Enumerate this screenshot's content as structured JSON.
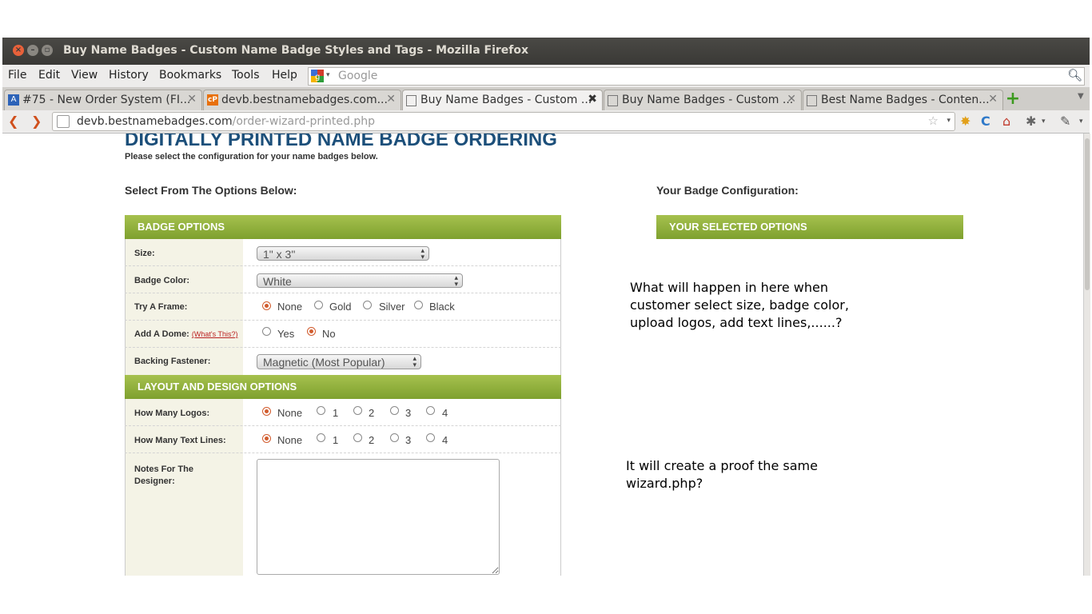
{
  "window": {
    "title": "Buy Name Badges - Custom Name Badge Styles and Tags - Mozilla Firefox"
  },
  "menubar": {
    "items": [
      "File",
      "Edit",
      "View",
      "History",
      "Bookmarks",
      "Tools",
      "Help"
    ],
    "search_placeholder": "Google"
  },
  "tabs": [
    {
      "label": "#75 - New Order System (FI...",
      "favicon": "A",
      "active": false
    },
    {
      "label": "devb.bestnamebadges.com...",
      "favicon": "cP",
      "active": false
    },
    {
      "label": "Buy Name Badges - Custom ...",
      "favicon": "",
      "active": true
    },
    {
      "label": "Buy Name Badges - Custom ...",
      "favicon": "",
      "active": false
    },
    {
      "label": "Best Name Badges - Conten...",
      "favicon": "",
      "active": false
    }
  ],
  "navbar": {
    "url_domain": "devb.bestnamebadges.com",
    "url_path": "/order-wizard-printed.php"
  },
  "page": {
    "title": "DIGITALLY PRINTED NAME BADGE ORDERING",
    "subtitle": "Please select the configuration for your name badges below.",
    "left_heading": "Select From The Options Below:",
    "right_heading": "Your Badge Configuration:",
    "badge_options_header": "BADGE OPTIONS",
    "selected_options_header": "YOUR SELECTED OPTIONS",
    "layout_header": "LAYOUT AND DESIGN OPTIONS",
    "rows": {
      "size": {
        "label": "Size:",
        "value": "1\" x 3\""
      },
      "badge_color": {
        "label": "Badge Color:",
        "value": "White"
      },
      "frame": {
        "label": "Try A Frame:",
        "options": [
          "None",
          "Gold",
          "Silver",
          "Black"
        ],
        "selected": "None"
      },
      "dome": {
        "label": "Add A Dome:",
        "link": "(What's This?)",
        "options": [
          "Yes",
          "No"
        ],
        "selected": "No"
      },
      "backing": {
        "label": "Backing Fastener:",
        "value": "Magnetic (Most Popular)"
      },
      "logos": {
        "label": "How Many Logos:",
        "options": [
          "None",
          "1",
          "2",
          "3",
          "4"
        ],
        "selected": "None"
      },
      "text_lines": {
        "label": "How Many Text Lines:",
        "options": [
          "None",
          "1",
          "2",
          "3",
          "4"
        ],
        "selected": "None"
      },
      "notes": {
        "label_line1": "Notes For The",
        "label_line2": "Designer:"
      }
    }
  },
  "annotations": {
    "note1_line1": "What will happen in here when",
    "note1_line2": "customer select size, badge color,",
    "note1_line3": "upload logos, add text lines,......?",
    "note2_line1": "It will create a proof the same",
    "note2_line2": "wizard.php?"
  },
  "colors": {
    "title_blue": "#1c4f7a",
    "green_bar": "#8fae3a",
    "radio_selected": "#d15c2e",
    "label_column_bg": "#f4f3e6"
  }
}
